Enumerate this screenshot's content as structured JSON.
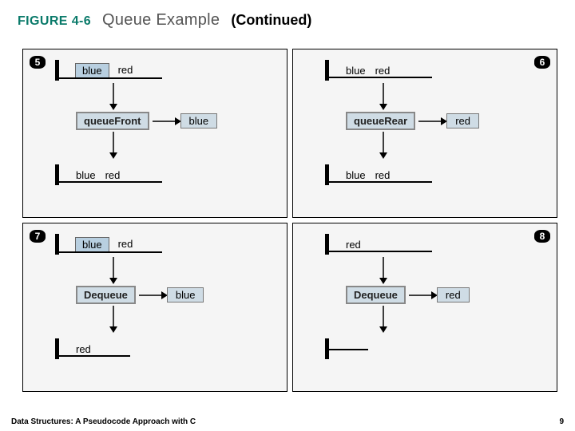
{
  "header": {
    "label": "FIGURE 4-6",
    "title": "Queue Example",
    "continued": "(Continued)"
  },
  "panels": [
    {
      "step": "5",
      "badge_side": "left",
      "queue_before": [
        "blue",
        "red"
      ],
      "before_highlight_first": true,
      "operation": "queueFront",
      "output": "blue",
      "queue_after": [
        "blue",
        "red"
      ]
    },
    {
      "step": "6",
      "badge_side": "right",
      "queue_before": [
        "blue",
        "red"
      ],
      "before_highlight_first": false,
      "operation": "queueRear",
      "output": "red",
      "queue_after": [
        "blue",
        "red"
      ]
    },
    {
      "step": "7",
      "badge_side": "left",
      "queue_before": [
        "blue",
        "red"
      ],
      "before_highlight_first": true,
      "operation": "Dequeue",
      "output": "blue",
      "queue_after": [
        "red"
      ]
    },
    {
      "step": "8",
      "badge_side": "right",
      "queue_before": [
        "red"
      ],
      "before_highlight_first": false,
      "operation": "Dequeue",
      "output": "red",
      "queue_after": []
    }
  ],
  "footer": {
    "book": "Data Structures: A Pseudocode Approach with C",
    "page": "9"
  }
}
